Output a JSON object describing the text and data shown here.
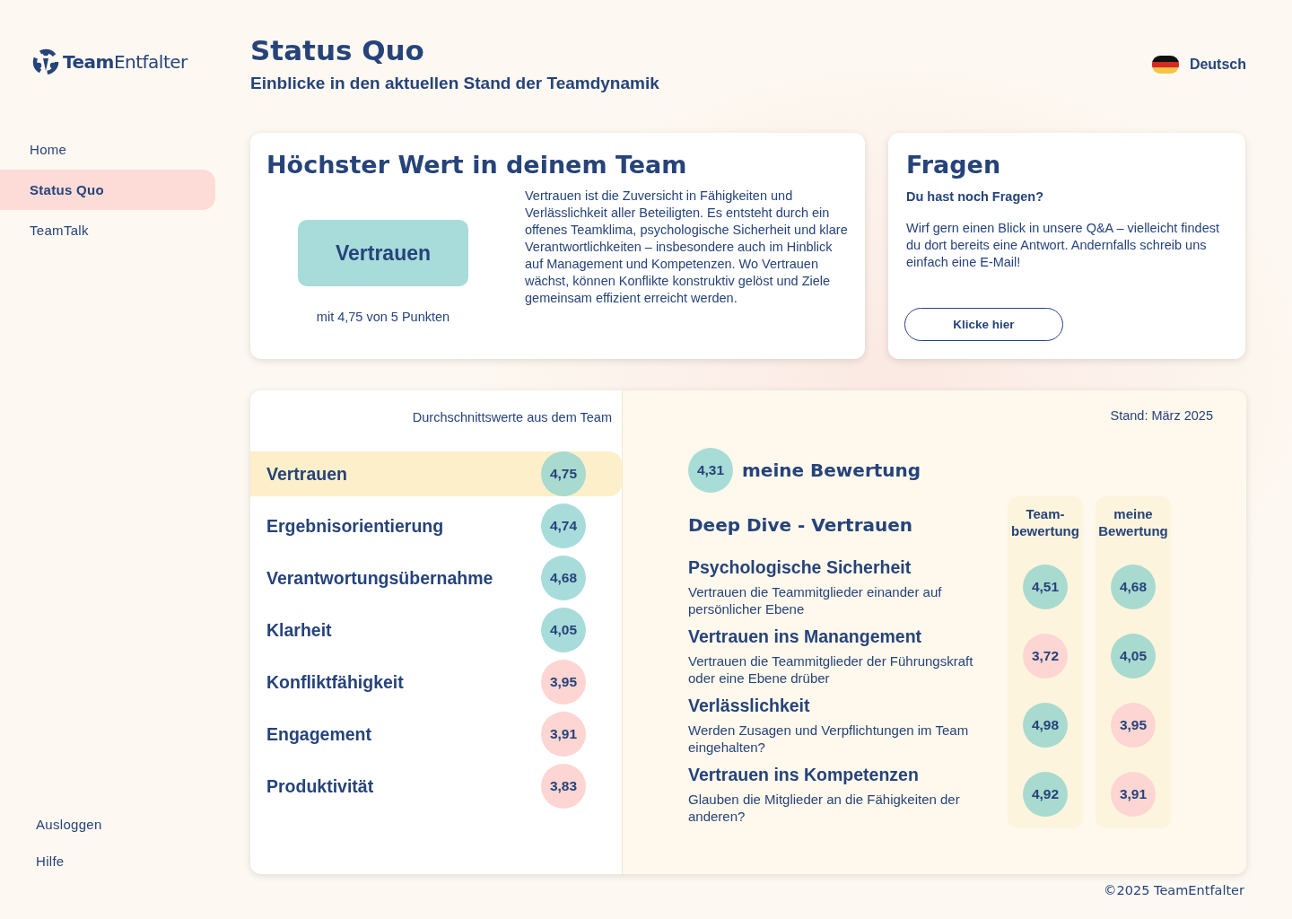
{
  "brand": {
    "bold": "Team",
    "light": "Entfalter"
  },
  "nav": [
    {
      "label": "Home",
      "selected": false
    },
    {
      "label": "Status Quo",
      "selected": true
    },
    {
      "label": "TeamTalk",
      "selected": false
    }
  ],
  "nav_bottom": [
    "Ausloggen",
    "Hilfe"
  ],
  "header": {
    "title": "Status Quo",
    "subtitle": "Einblicke in den aktuellen Stand der Teamdynamik",
    "language": "Deutsch"
  },
  "top_value": {
    "title": "Höchster Wert in deinem Team",
    "value": "Vertrauen",
    "score_text": "mit 4,75 von 5 Punkten",
    "description": "Vertrauen ist die Zuversicht in Fähigkeiten und Verlässlichkeit aller Beteiligten. Es entsteht durch ein offenes Teamklima, psychologische Sicherheit und klare Verantwortlichkeiten – insbesondere auch im Hinblick auf Management und Kompetenzen. Wo Vertrauen wächst, können Konflikte konstruktiv gelöst und Ziele gemeinsam effizient erreicht werden."
  },
  "questions": {
    "title": "Fragen",
    "subtitle": "Du hast noch Fragen?",
    "text": "Wirf gern einen Blick in unsere Q&A – vielleicht findest du dort bereits eine Antwort. Andernfalls schreib uns einfach eine E-Mail!",
    "button": "Klicke hier"
  },
  "averages": {
    "caption": "Durchschnittswerte aus dem Team",
    "items": [
      {
        "label": "Vertrauen",
        "score": "4,75",
        "color": "#a8dacf",
        "selected": true
      },
      {
        "label": "Ergebnisorientierung",
        "score": "4,74",
        "color": "#a8dcdb",
        "selected": false
      },
      {
        "label": "Verantwortungsübernahme",
        "score": "4,68",
        "color": "#a8dcdb",
        "selected": false
      },
      {
        "label": "Klarheit",
        "score": "4,05",
        "color": "#a8dcdb",
        "selected": false
      },
      {
        "label": "Konfliktfähigkeit",
        "score": "3,95",
        "color": "#fdd5d2",
        "selected": false
      },
      {
        "label": "Engagement",
        "score": "3,91",
        "color": "#fdd5d2",
        "selected": false
      },
      {
        "label": "Produktivität",
        "score": "3,83",
        "color": "#fdd5d2",
        "selected": false
      }
    ]
  },
  "deep_dive": {
    "date": "Stand: März 2025",
    "my_score": "4,31",
    "my_label": "meine Bewertung",
    "title": "Deep Dive - Vertrauen",
    "col_team": "Team-\nbewertung",
    "col_mine": "meine\nBewertung",
    "items": [
      {
        "title": "Psychologische Sicherheit",
        "text": "Vertrauen die Teammitglieder einander auf persönlicher Ebene",
        "team": {
          "score": "4,51",
          "color": "#a8dacf"
        },
        "mine": {
          "score": "4,68",
          "color": "#a8dacf"
        }
      },
      {
        "title": "Vertrauen ins Manangement",
        "text": "Vertrauen die Teammitglieder der Führungskraft oder eine Ebene drüber",
        "team": {
          "score": "3,72",
          "color": "#fdd5d2"
        },
        "mine": {
          "score": "4,05",
          "color": "#a8dacf"
        }
      },
      {
        "title": "Verlässlichkeit",
        "text": "Werden Zusagen und Verpflichtungen im Team eingehalten?",
        "team": {
          "score": "4,98",
          "color": "#a8dacf"
        },
        "mine": {
          "score": "3,95",
          "color": "#fdd5d2"
        }
      },
      {
        "title": "Vertrauen ins Kompetenzen",
        "text": "Glauben die Mitglieder an die Fähigkeiten der anderen?",
        "team": {
          "score": "4,92",
          "color": "#a8dacf"
        },
        "mine": {
          "score": "3,91",
          "color": "#fdd5d2"
        }
      }
    ]
  },
  "footer": "©2025 TeamEntfalter"
}
